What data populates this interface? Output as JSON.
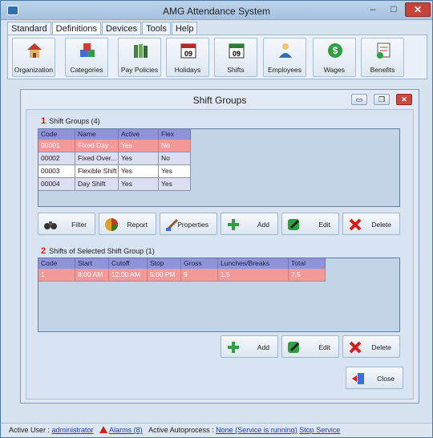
{
  "window": {
    "title": "AMG Attendance System",
    "min": "–",
    "max": "□",
    "close": "✕"
  },
  "menu": [
    "Standard",
    "Definitions",
    "Devices",
    "Tools",
    "Help"
  ],
  "ribbon": [
    {
      "label": "Organization",
      "icon": "house-icon"
    },
    {
      "label": "Categories",
      "icon": "cubes-icon"
    },
    {
      "label": "Pay Policies",
      "icon": "books-icon"
    },
    {
      "label": "Holidays",
      "icon": "calendar-icon",
      "num": "09"
    },
    {
      "label": "Shifts",
      "icon": "calendar-icon",
      "num": "09"
    },
    {
      "label": "Employees",
      "icon": "person-icon"
    },
    {
      "label": "Wages",
      "icon": "dollar-icon"
    },
    {
      "label": "Benefits",
      "icon": "benefits-icon"
    }
  ],
  "child": {
    "title": "Shift Groups",
    "groups": {
      "num": "1",
      "title": "Shift Groups (4)",
      "columns": [
        "Code",
        "Name",
        "Active",
        "Flex"
      ],
      "rows": [
        [
          "00001",
          "Fixed Day ...",
          "Yes",
          "No"
        ],
        [
          "00002",
          "Fixed Over...",
          "Yes",
          "No"
        ],
        [
          "00003",
          "Flexible Shift",
          "Yes",
          "Yes"
        ],
        [
          "00004",
          "Day Shift",
          "Yes",
          "Yes"
        ]
      ]
    },
    "group_buttons": [
      "Filter",
      "Report",
      "Properties",
      "Add",
      "Edit",
      "Delete"
    ],
    "shifts": {
      "num": "2",
      "title": "Shifts of Selected Shift Group (1)",
      "columns": [
        "Code",
        "Start",
        "Cutoff",
        "Stop",
        "Gross",
        "Lunches/Breaks",
        "Total"
      ],
      "rows": [
        [
          "1",
          "8:00 AM",
          "12:00 AM",
          "5:00 PM",
          "9",
          "1.5",
          "7.5"
        ]
      ]
    },
    "shift_buttons": [
      "Add",
      "Edit",
      "Delete"
    ],
    "close_label": "Close"
  },
  "status": {
    "user_label": "Active User :",
    "user": "administrator",
    "alarms": "Alarms (8)",
    "autoprocess_label": "Active Autoprocess :",
    "autoprocess": "None (Service is running)",
    "stop": "Stop Service"
  },
  "colors": {
    "selected_row": "#f39a98",
    "header": "#8f93d8",
    "accent_red": "#d81b1b"
  }
}
